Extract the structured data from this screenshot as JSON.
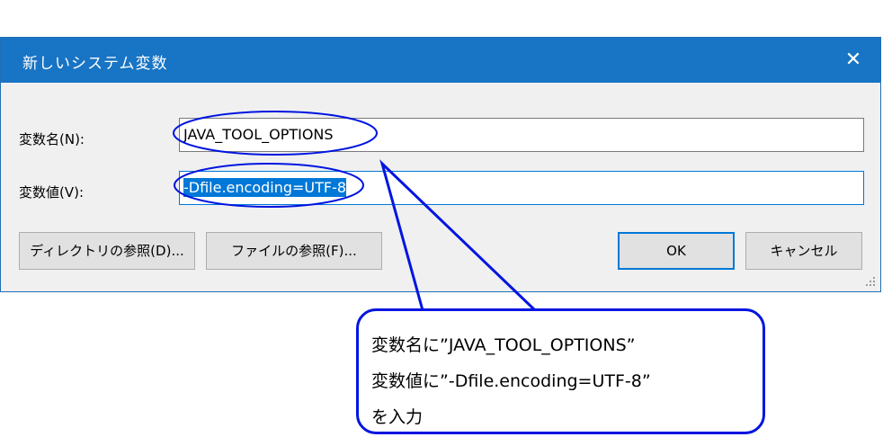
{
  "dialog": {
    "title": "新しいシステム変数",
    "close_glyph": "✕",
    "name_label": "変数名(N):",
    "value_label": "変数値(V):",
    "name_value": "JAVA_TOOL_OPTIONS",
    "value_value": "-Dfile.encoding=UTF-8",
    "browse_directory_label": "ディレクトリの参照(D)...",
    "browse_file_label": "ファイルの参照(F)...",
    "ok_label": "OK",
    "cancel_label": "キャンセル"
  },
  "callout": {
    "line1": "変数名に”JAVA_TOOL_OPTIONS”",
    "line2": "変数値に”-Dfile.encoding=UTF-8”",
    "line3": "を入力"
  },
  "colors": {
    "titlebar": "#1874c4",
    "annotation": "#0015e0",
    "selection": "#0078d7"
  }
}
